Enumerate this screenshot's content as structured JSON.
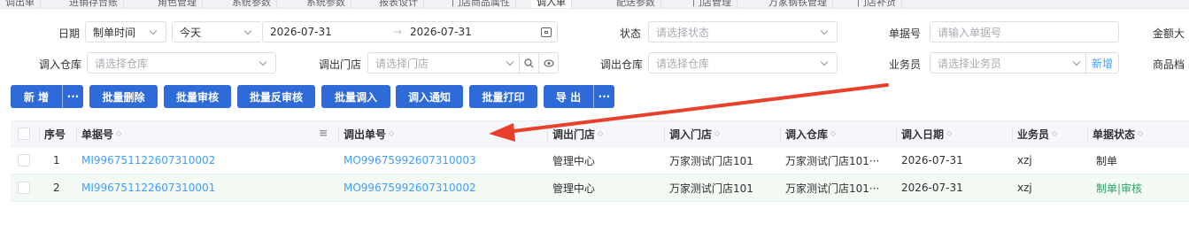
{
  "tabs": [
    {
      "label": "调出单"
    },
    {
      "label": "进销存台账"
    },
    {
      "label": "角色管理"
    },
    {
      "label": "系统参数"
    },
    {
      "label": "系统参数"
    },
    {
      "label": "报表设计"
    },
    {
      "label": "门店商品属性"
    },
    {
      "label": "调入单"
    },
    {
      "label": "配送参数"
    },
    {
      "label": "门店管理"
    },
    {
      "label": "万家钢铁管理"
    },
    {
      "label": "门店补货"
    }
  ],
  "filters": {
    "date_label": "日期",
    "date_type_value": "制单时间",
    "date_preset_value": "今天",
    "date_start": "2026-07-31",
    "date_end": "2026-07-31",
    "status_label": "状态",
    "status_placeholder": "请选择状态",
    "doc_no_label": "单据号",
    "doc_no_placeholder": "请输入单据号",
    "amount_label": "金额大",
    "in_warehouse_label": "调入仓库",
    "in_warehouse_placeholder": "请选择仓库",
    "out_store_label": "调出门店",
    "out_store_placeholder": "请选择门店",
    "out_warehouse_label": "调出仓库",
    "out_warehouse_placeholder": "请选择仓库",
    "salesman_label": "业务员",
    "salesman_placeholder": "请选择业务员",
    "salesman_extra_link": "新增",
    "goods_label": "商品档"
  },
  "toolbar": {
    "add": "新 增",
    "more": "···",
    "batch_delete": "批量删除",
    "batch_approve": "批量审核",
    "batch_unapprove": "批量反审核",
    "batch_in": "批量调入",
    "notify_in": "调入通知",
    "batch_print": "批量打印",
    "export": "导 出",
    "export_more": "···"
  },
  "table": {
    "columns": [
      "序号",
      "单据号",
      "调出单号",
      "调出门店",
      "调入门店",
      "调入仓库",
      "调入日期",
      "业务员",
      "单据状态"
    ],
    "rows": [
      {
        "index": "1",
        "doc_no": "MI996751122607310002",
        "out_no": "MO99675992607310003",
        "out_store": "管理中心",
        "in_store": "万家测试门店101",
        "in_warehouse": "万家测试门店101···",
        "in_date": "2026-07-31",
        "salesman": "xzj",
        "status": "制单"
      },
      {
        "index": "2",
        "doc_no": "MI996751122607310001",
        "out_no": "MO99675992607310002",
        "out_store": "管理中心",
        "in_store": "万家测试门店101",
        "in_warehouse": "万家测试门店101···",
        "in_date": "2026-07-31",
        "salesman": "xzj",
        "status": "制单|审核"
      }
    ]
  },
  "colors": {
    "primary": "#2f6bd8",
    "link": "#409eff",
    "status_ok": "#2fa36b",
    "arrow": "#e8402b"
  }
}
